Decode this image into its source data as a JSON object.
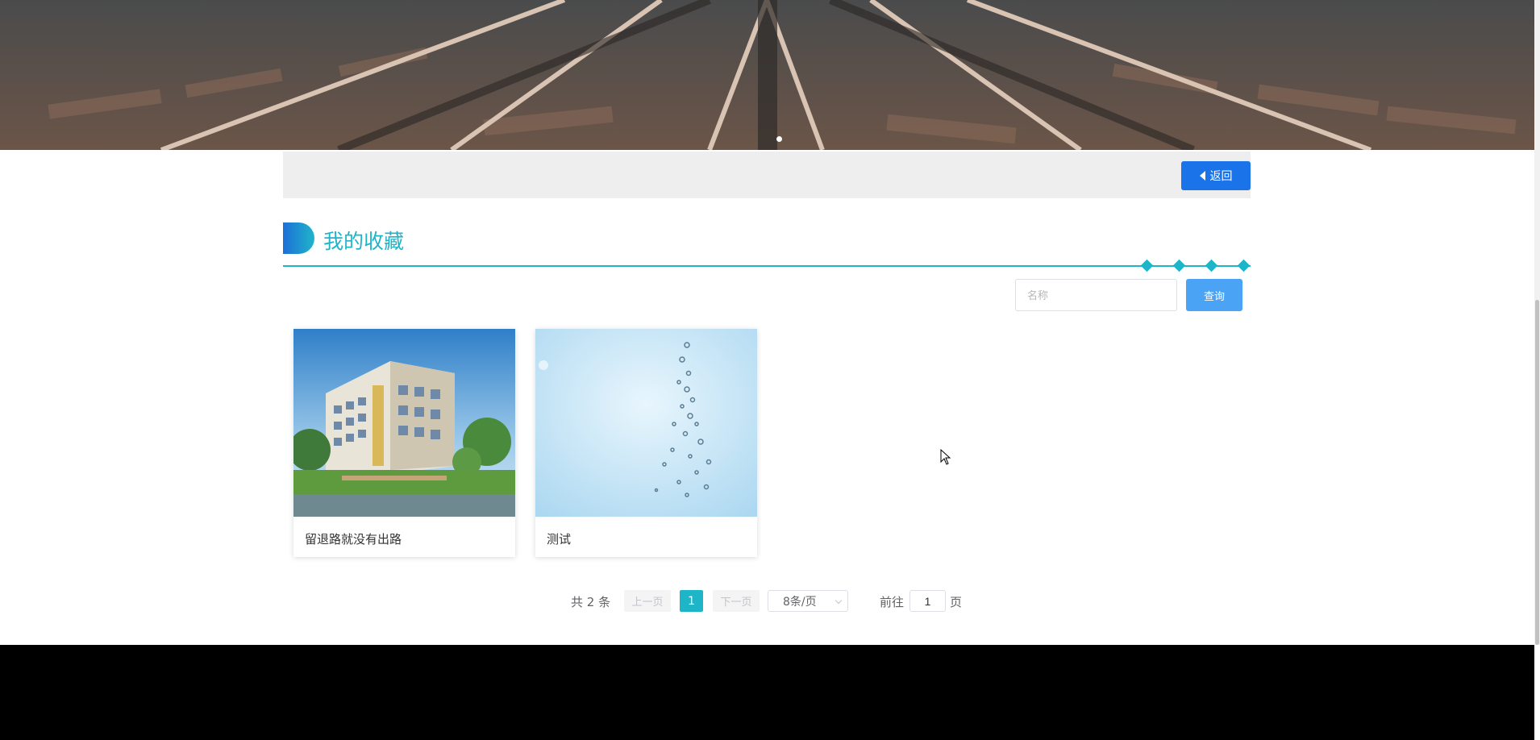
{
  "header": {
    "back_label": "返回"
  },
  "section": {
    "title": "我的收藏"
  },
  "search": {
    "placeholder": "名称",
    "value": "",
    "button_label": "查询"
  },
  "favorites": [
    {
      "title": "留退路就没有出路"
    },
    {
      "title": "测试"
    }
  ],
  "pagination": {
    "total_text": "共 2 条",
    "prev_label": "上一页",
    "current_page": "1",
    "next_label": "下一页",
    "page_size": "8条/页",
    "goto_label": "前往",
    "goto_value": "1",
    "page_suffix": "页"
  },
  "colors": {
    "accent": "#1fb5c9",
    "primary_button": "#1a73e8",
    "search_button": "#4aa3f5"
  }
}
